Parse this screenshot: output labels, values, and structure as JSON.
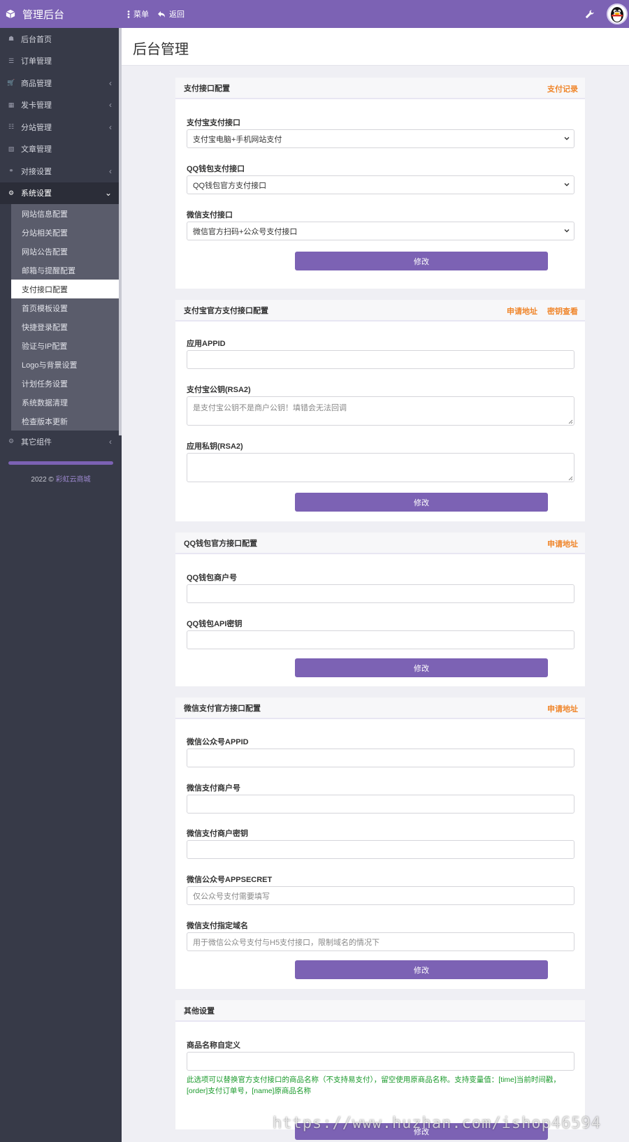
{
  "app": {
    "title": "管理后台"
  },
  "topnav": {
    "menu": "菜单",
    "back": "返回"
  },
  "sidebar": {
    "items": [
      {
        "label": "后台首页",
        "icon": "home-icon"
      },
      {
        "label": "订单管理",
        "icon": "list-icon"
      },
      {
        "label": "商品管理",
        "icon": "cart-icon",
        "chevron": "‹"
      },
      {
        "label": "发卡管理",
        "icon": "grid-icon",
        "chevron": "‹"
      },
      {
        "label": "分站管理",
        "icon": "sitemap-icon",
        "chevron": "‹"
      },
      {
        "label": "文章管理",
        "icon": "book-icon"
      },
      {
        "label": "对接设置",
        "icon": "link-icon",
        "chevron": "‹"
      },
      {
        "label": "系统设置",
        "icon": "gear-icon",
        "chevron": "⌄"
      }
    ],
    "sub_items": [
      "网站信息配置",
      "分站相关配置",
      "网站公告配置",
      "邮箱与提醒配置",
      "支付接口配置",
      "首页模板设置",
      "快捷登录配置",
      "验证与IP配置",
      "Logo与背景设置",
      "计划任务设置",
      "系统数据清理",
      "检查版本更新"
    ],
    "other": {
      "label": "其它组件",
      "chevron": "‹"
    },
    "copyright_prefix": "2022 ©",
    "copyright_link": "彩虹云商城"
  },
  "page": {
    "title": "后台管理"
  },
  "panels": {
    "pay": {
      "title": "支付接口配置",
      "link1": "支付记录",
      "alipay_label": "支付宝支付接口",
      "alipay_value": "支付宝电脑+手机网站支付",
      "qq_label": "QQ钱包支付接口",
      "qq_value": "QQ钱包官方支付接口",
      "wx_label": "微信支付接口",
      "wx_value": "微信官方扫码+公众号支付接口",
      "submit": "修改"
    },
    "alipay": {
      "title": "支付宝官方支付接口配置",
      "link1": "申请地址",
      "link2": "密钥查看",
      "appid_label": "应用APPID",
      "pubkey_label": "支付宝公钥(RSA2)",
      "pubkey_placeholder": "是支付宝公钥不是商户公钥！填错会无法回调",
      "privkey_label": "应用私钥(RSA2)",
      "submit": "修改"
    },
    "qq": {
      "title": "QQ钱包官方接口配置",
      "link1": "申请地址",
      "mch_label": "QQ钱包商户号",
      "key_label": "QQ钱包API密钥",
      "submit": "修改"
    },
    "wx": {
      "title": "微信支付官方接口配置",
      "link1": "申请地址",
      "appid_label": "微信公众号APPID",
      "mch_label": "微信支付商户号",
      "key_label": "微信支付商户密钥",
      "secret_label": "微信公众号APPSECRET",
      "secret_placeholder": "仅公众号支付需要填写",
      "domain_label": "微信支付指定域名",
      "domain_placeholder": "用于微信公众号支付与H5支付接口，限制域名的情况下",
      "submit": "修改"
    },
    "other": {
      "title": "其他设置",
      "name_label": "商品名称自定义",
      "help": "此选项可以替换官方支付接口的商品名称（不支持易支付），留空使用原商品名称。支持变量值：[time]当前时间戳，[order]支付订单号，[name]原商品名称",
      "submit": "修改"
    }
  },
  "watermark": "https://www.huzhan.com/ishop46594",
  "colors": {
    "accent": "#7c62b4",
    "link_orange": "#f0862b",
    "help_green": "#1a9a2b",
    "sidebar": "#373a48"
  }
}
